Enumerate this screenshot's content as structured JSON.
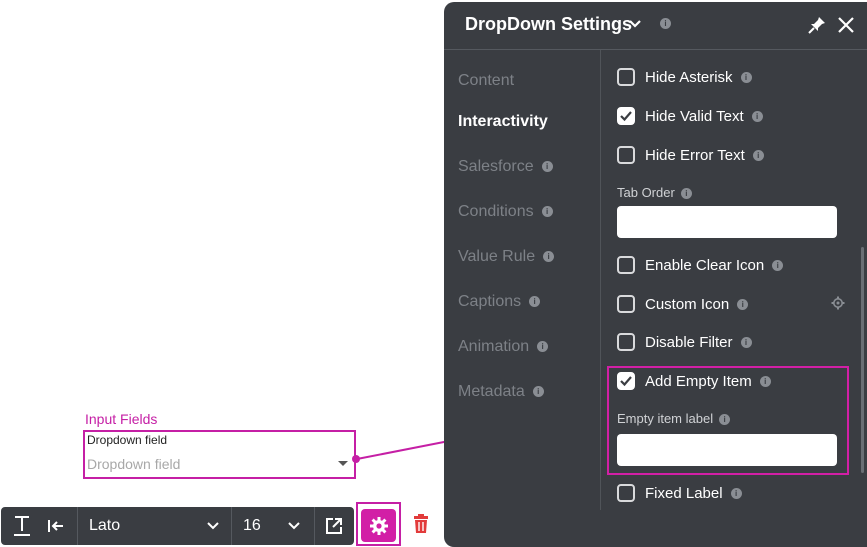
{
  "panel": {
    "title": "DropDown Settings",
    "nav": [
      {
        "label": "Content",
        "active": false,
        "info": false
      },
      {
        "label": "Interactivity",
        "active": true,
        "info": false
      },
      {
        "label": "Salesforce",
        "active": false,
        "info": true
      },
      {
        "label": "Conditions",
        "active": false,
        "info": true
      },
      {
        "label": "Value Rule",
        "active": false,
        "info": true
      },
      {
        "label": "Captions",
        "active": false,
        "info": true
      },
      {
        "label": "Animation",
        "active": false,
        "info": true
      },
      {
        "label": "Metadata",
        "active": false,
        "info": true
      }
    ],
    "options": {
      "hide_asterisk": {
        "label": "Hide Asterisk",
        "checked": false
      },
      "hide_valid_text": {
        "label": "Hide Valid Text",
        "checked": true
      },
      "hide_error_text": {
        "label": "Hide Error Text",
        "checked": false
      },
      "tab_order_label": "Tab Order",
      "tab_order_value": "",
      "enable_clear_icon": {
        "label": "Enable Clear Icon",
        "checked": false
      },
      "custom_icon": {
        "label": "Custom Icon",
        "checked": false
      },
      "disable_filter": {
        "label": "Disable Filter",
        "checked": false
      },
      "add_empty_item": {
        "label": "Add Empty Item",
        "checked": true
      },
      "empty_item_label": "Empty item label",
      "empty_item_value": "",
      "fixed_label": {
        "label": "Fixed Label",
        "checked": false
      }
    },
    "info_glyph": "i"
  },
  "canvas": {
    "caption": "Input Fields",
    "dropdown_label": "Dropdown field",
    "dropdown_placeholder": "Dropdown field"
  },
  "toolbar": {
    "font_family": "Lato",
    "font_size": "16"
  },
  "colors": {
    "panel_bg": "#3a3d42",
    "accent": "#d21fa6",
    "delete": "#e23b3b"
  }
}
